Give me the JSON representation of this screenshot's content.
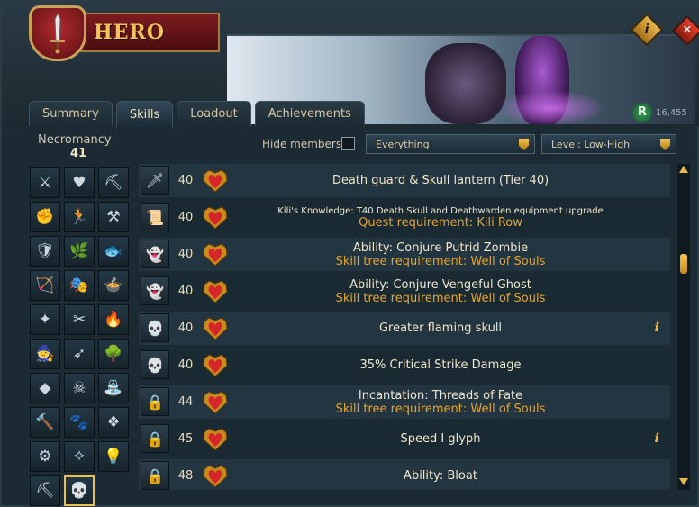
{
  "window": {
    "title": "HERO",
    "runecoins": "16,455"
  },
  "tabs": [
    {
      "label": "Summary"
    },
    {
      "label": "Skills"
    },
    {
      "label": "Loadout"
    },
    {
      "label": "Achievements"
    }
  ],
  "skill_panel": {
    "name": "Necromancy",
    "level": "41"
  },
  "filters": {
    "hide_members_label": "Hide members",
    "type_selected": "Everything",
    "sort_selected": "Level: Low-High"
  },
  "skill_icons": [
    {
      "name": "attack",
      "glyph": "⚔"
    },
    {
      "name": "constitution",
      "glyph": "♥"
    },
    {
      "name": "mining",
      "glyph": "⛏"
    },
    {
      "name": "strength",
      "glyph": "✊"
    },
    {
      "name": "agility",
      "glyph": "🏃"
    },
    {
      "name": "smithing",
      "glyph": "⚒"
    },
    {
      "name": "defence",
      "glyph": "🛡"
    },
    {
      "name": "herblore",
      "glyph": "🌿"
    },
    {
      "name": "fishing",
      "glyph": "🐟"
    },
    {
      "name": "ranged",
      "glyph": "🏹"
    },
    {
      "name": "thieving",
      "glyph": "🎭"
    },
    {
      "name": "cooking",
      "glyph": "🍲"
    },
    {
      "name": "prayer",
      "glyph": "✦"
    },
    {
      "name": "crafting",
      "glyph": "✂"
    },
    {
      "name": "firemaking",
      "glyph": "🔥"
    },
    {
      "name": "magic",
      "glyph": "🧙"
    },
    {
      "name": "fletching",
      "glyph": "➶"
    },
    {
      "name": "woodcutting",
      "glyph": "🌳"
    },
    {
      "name": "runecrafting",
      "glyph": "◆"
    },
    {
      "name": "slayer",
      "glyph": "☠"
    },
    {
      "name": "farming",
      "glyph": "⛲"
    },
    {
      "name": "construction",
      "glyph": "🔨"
    },
    {
      "name": "hunter",
      "glyph": "🐾"
    },
    {
      "name": "summoning",
      "glyph": "❖"
    },
    {
      "name": "dungeoneering",
      "glyph": "⚙"
    },
    {
      "name": "divination",
      "glyph": "✧"
    },
    {
      "name": "invention",
      "glyph": "💡"
    },
    {
      "name": "archaeology",
      "glyph": "⛏"
    },
    {
      "name": "necromancy",
      "glyph": "💀"
    }
  ],
  "unlocks": [
    {
      "icon": "staff-icon",
      "glyph": "🗡",
      "level": "40",
      "title": "Death guard & Skull lantern (Tier 40)",
      "req": "",
      "info": ""
    },
    {
      "icon": "scroll-icon",
      "glyph": "📜",
      "level": "40",
      "title": "Kili's Knowledge: T40 Death Skull and Deathwarden equipment upgrade",
      "req": "Quest requirement: Kili Row",
      "info": ""
    },
    {
      "icon": "zombie-icon",
      "glyph": "👻",
      "level": "40",
      "title": "Ability: Conjure Putrid Zombie",
      "req": "Skill tree requirement: Well of Souls",
      "info": ""
    },
    {
      "icon": "ghost-icon",
      "glyph": "👻",
      "level": "40",
      "title": "Ability: Conjure Vengeful Ghost",
      "req": "Skill tree requirement: Well of Souls",
      "info": ""
    },
    {
      "icon": "flaming-skull-icon",
      "glyph": "💀",
      "level": "40",
      "title": "Greater flaming skull",
      "req": "",
      "info": "i"
    },
    {
      "icon": "skull-icon",
      "glyph": "💀",
      "level": "40",
      "title": "35% Critical Strike Damage",
      "req": "",
      "info": ""
    },
    {
      "icon": "lock-icon",
      "glyph": "🔒",
      "level": "44",
      "title": "Incantation: Threads of Fate",
      "req": "Skill tree requirement: Well of Souls",
      "info": ""
    },
    {
      "icon": "lock-icon",
      "glyph": "🔒",
      "level": "45",
      "title": "Speed I glyph",
      "req": "",
      "info": "i"
    },
    {
      "icon": "lock-icon",
      "glyph": "🔒",
      "level": "48",
      "title": "Ability: Bloat",
      "req": "",
      "info": ""
    }
  ],
  "colors": {
    "accent_gold": "#e8b84a",
    "requirement_orange": "#e2a433",
    "title_red": "#7c1c20"
  }
}
